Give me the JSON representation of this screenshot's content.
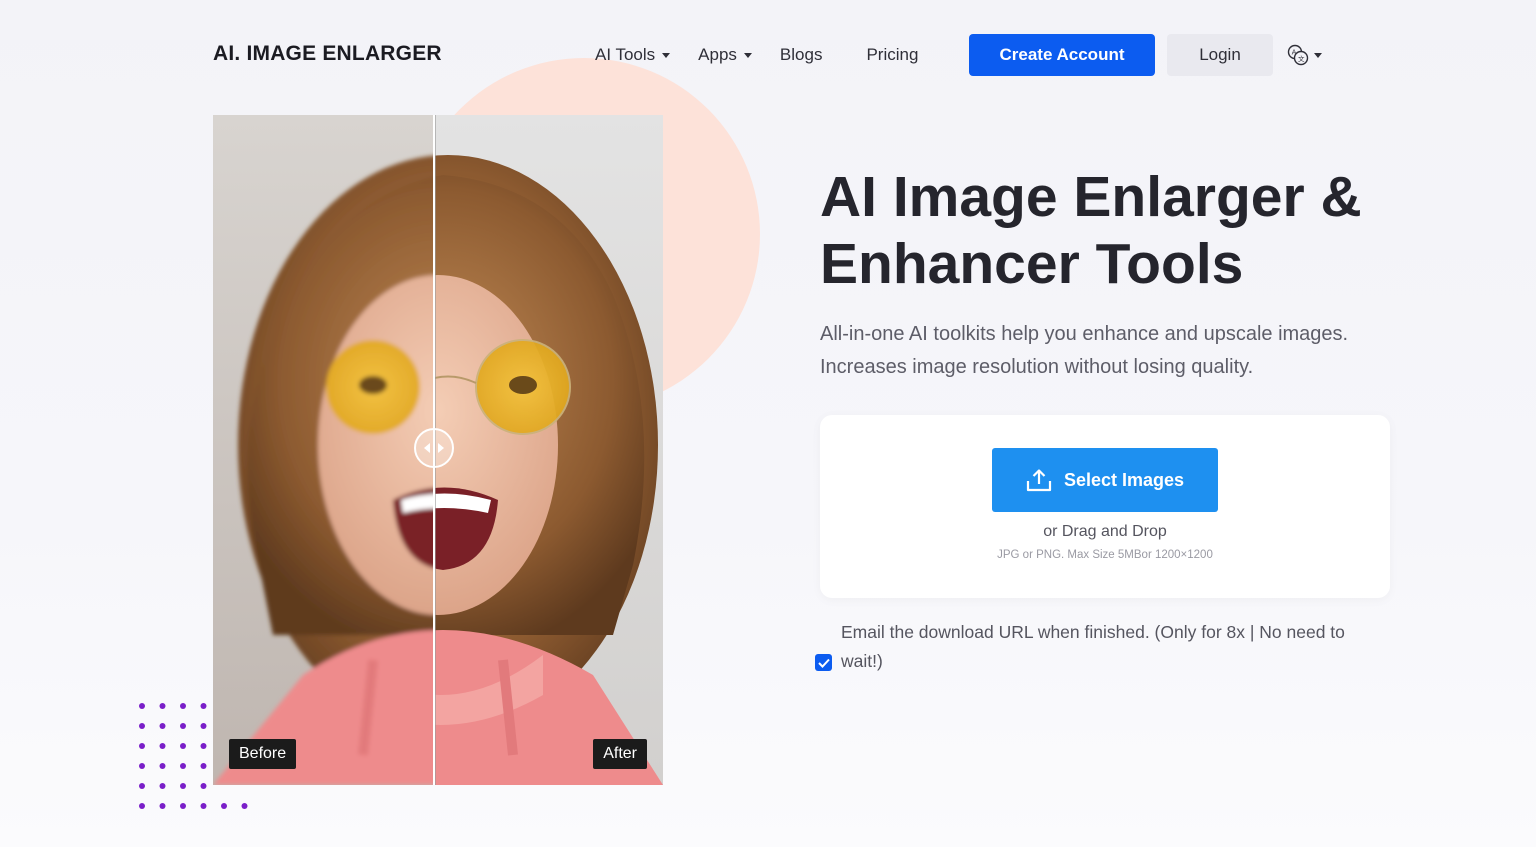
{
  "header": {
    "logo": "AI. IMAGE ENLARGER",
    "nav": [
      {
        "label": "AI Tools",
        "dropdown": true
      },
      {
        "label": "Apps",
        "dropdown": true
      },
      {
        "label": "Blogs",
        "dropdown": false
      },
      {
        "label": "Pricing",
        "dropdown": false
      }
    ],
    "create_account": "Create Account",
    "login": "Login",
    "language_icon": "translate-icon"
  },
  "compare": {
    "before_label": "Before",
    "after_label": "After",
    "handle_icon": "left-right-arrows-icon"
  },
  "hero": {
    "title_line1": "AI Image Enlarger &",
    "title_line2": "Enhancer Tools",
    "subtitle_line1": "All-in-one AI toolkits help you enhance and upscale images.",
    "subtitle_line2": "Increases image resolution without losing quality."
  },
  "upload": {
    "button_label": "Select Images",
    "button_icon": "upload-icon",
    "drag_text": "or Drag and Drop",
    "formats_text": "JPG or PNG. Max Size 5MBor 1200×1200"
  },
  "email_option": {
    "checked": true,
    "text_line1": "Email the download URL when finished. (Only for 8x | No need to",
    "text_line2": "wait!)"
  },
  "colors": {
    "primary": "#0c5cf0",
    "select_button": "#1e90f0",
    "circle": "#fde2d9",
    "dots": "#7a1fc9"
  }
}
